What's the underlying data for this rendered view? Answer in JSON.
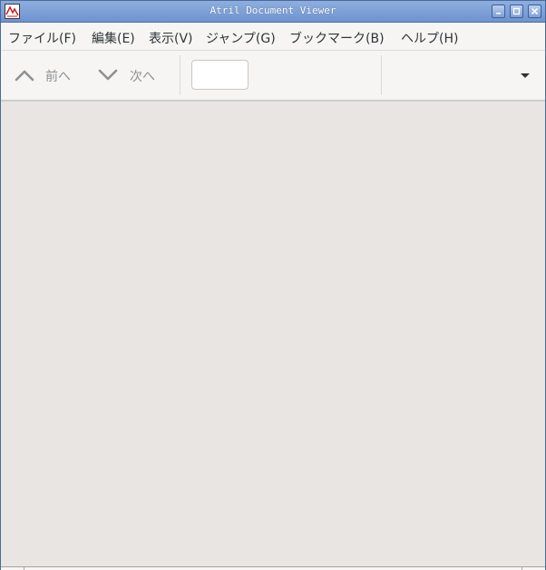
{
  "window": {
    "title": "Atril Document Viewer"
  },
  "titlebar_buttons": {
    "minimize": "minimize-icon",
    "maximize": "maximize-icon",
    "close": "close-icon"
  },
  "menubar": {
    "items": [
      {
        "label": "ファイル(F)"
      },
      {
        "label": "編集(E)"
      },
      {
        "label": "表示(V)"
      },
      {
        "label": "ジャンプ(G)"
      },
      {
        "label": "ブックマーク(B)"
      },
      {
        "label": "ヘルプ(H)"
      }
    ]
  },
  "toolbar": {
    "prev_label": "前へ",
    "next_label": "次へ",
    "page_value": ""
  },
  "colors": {
    "titlebar": "#7b9ed6",
    "background": "#f6f5f4",
    "document_area": "#e8e5e2",
    "disabled_text": "#8e9093"
  }
}
